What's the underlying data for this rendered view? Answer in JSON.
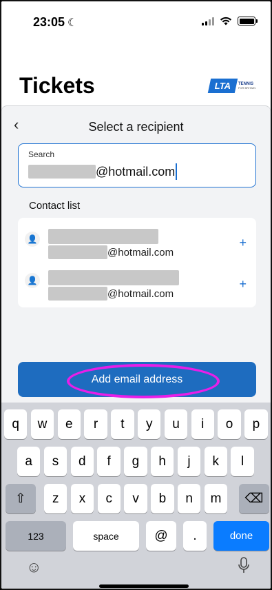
{
  "status_bar": {
    "time": "23:05"
  },
  "header": {
    "title": "Tickets",
    "logo_mark": "LTA",
    "logo_text": "TENNIS",
    "logo_subtext": "FOR BRITAIN"
  },
  "sheet": {
    "title": "Select a recipient",
    "search": {
      "label": "Search",
      "value_suffix": "@hotmail.com"
    },
    "contact_heading": "Contact list",
    "contacts": [
      {
        "email_suffix": "@hotmail.com",
        "add_icon": "+"
      },
      {
        "email_suffix": "@hotmail.com",
        "add_icon": "+"
      }
    ],
    "add_button_label": "Add email address"
  },
  "keyboard": {
    "row1": [
      "q",
      "w",
      "e",
      "r",
      "t",
      "y",
      "u",
      "i",
      "o",
      "p"
    ],
    "row2": [
      "a",
      "s",
      "d",
      "f",
      "g",
      "h",
      "j",
      "k",
      "l"
    ],
    "row3": [
      "z",
      "x",
      "c",
      "v",
      "b",
      "n",
      "m"
    ],
    "numbers_label": "123",
    "space_label": "space",
    "at_label": "@",
    "dot_label": ".",
    "done_label": "done"
  },
  "colors": {
    "accent": "#1e6cbf",
    "highlight": "#e81ee8",
    "done_key": "#0a7cff"
  }
}
